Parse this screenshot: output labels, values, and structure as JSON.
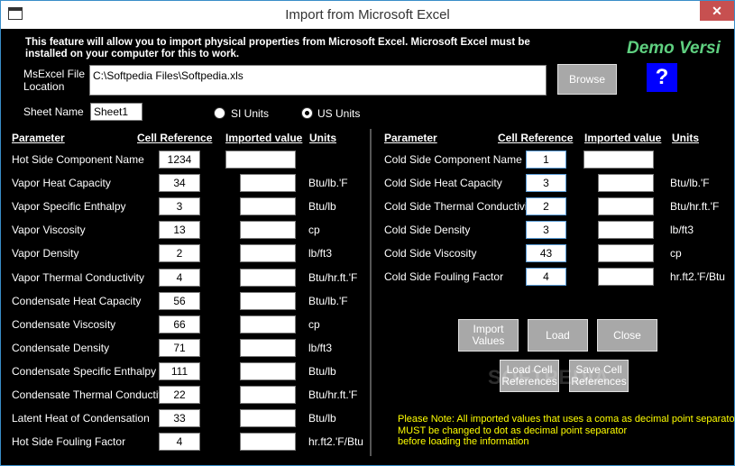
{
  "window": {
    "title": "Import from Microsoft Excel",
    "close_glyph": "✕",
    "icon": "window-icon"
  },
  "intro_text": "This feature will allow you to import physical properties from Microsoft Excel. Microsoft Excel must be installed on your computer for this to work.",
  "demo_label": "Demo Versi",
  "file": {
    "label": "MsExcel File Location",
    "value": "C:\\Softpedia Files\\Softpedia.xls",
    "browse_label": "Browse",
    "help_glyph": "?"
  },
  "sheet": {
    "label": "Sheet Name",
    "value": "Sheet1"
  },
  "units": {
    "options": [
      "SI Units",
      "US Units"
    ],
    "selected": "US Units"
  },
  "headers": {
    "parameter": "Parameter",
    "cell_reference": "Cell Reference",
    "imported_value": "Imported value",
    "units": "Units"
  },
  "hot_side": [
    {
      "name": "Hot Side Component Name",
      "cell": "1234",
      "unit": ""
    },
    {
      "name": "Vapor Heat Capacity",
      "cell": "34",
      "unit": "Btu/lb.'F"
    },
    {
      "name": "Vapor Specific Enthalpy",
      "cell": "3",
      "unit": "Btu/lb"
    },
    {
      "name": "Vapor Viscosity",
      "cell": "13",
      "unit": "cp"
    },
    {
      "name": "Vapor Density",
      "cell": "2",
      "unit": "lb/ft3"
    },
    {
      "name": "Vapor Thermal Conductivity",
      "cell": "4",
      "unit": "Btu/hr.ft.'F"
    },
    {
      "name": "Condensate Heat Capacity",
      "cell": "56",
      "unit": "Btu/lb.'F"
    },
    {
      "name": "Condensate Viscosity",
      "cell": "66",
      "unit": "cp"
    },
    {
      "name": "Condensate Density",
      "cell": "71",
      "unit": "lb/ft3"
    },
    {
      "name": "Condensate Specific Enthalpy",
      "cell": "111",
      "unit": "Btu/lb"
    },
    {
      "name": "Condensate Thermal Conductivity",
      "cell": "22",
      "unit": "Btu/hr.ft.'F"
    },
    {
      "name": "Latent Heat of Condensation",
      "cell": "33",
      "unit": "Btu/lb"
    },
    {
      "name": "Hot Side Fouling Factor",
      "cell": "4",
      "unit": "hr.ft2.'F/Btu"
    }
  ],
  "cold_side": [
    {
      "name": "Cold Side Component Name",
      "cell": "1",
      "unit": ""
    },
    {
      "name": "Cold Side Heat Capacity",
      "cell": "3",
      "unit": "Btu/lb.'F"
    },
    {
      "name": "Cold Side Thermal Conductivity",
      "cell": "2",
      "unit": "Btu/hr.ft.'F"
    },
    {
      "name": "Cold Side Density",
      "cell": "3",
      "unit": "lb/ft3"
    },
    {
      "name": "Cold Side Viscosity",
      "cell": "43",
      "unit": "cp"
    },
    {
      "name": "Cold Side Fouling Factor",
      "cell": "4",
      "unit": "hr.ft2.'F/Btu"
    }
  ],
  "buttons": {
    "import_values": "Import Values",
    "load": "Load",
    "close": "Close",
    "load_cell_references": "Load Cell References",
    "save_cell_references": "Save Cell References"
  },
  "note": [
    "Please Note: All imported values that uses a coma as decimal point separator",
    "MUST be changed to dot as decimal point separator",
    "before loading the information"
  ],
  "watermark": "SOFTPEDIA",
  "colors": {
    "background": "#000000",
    "demo": "#5fd080",
    "note": "#ffff00",
    "help": "#0000ff",
    "close": "#c75050"
  }
}
